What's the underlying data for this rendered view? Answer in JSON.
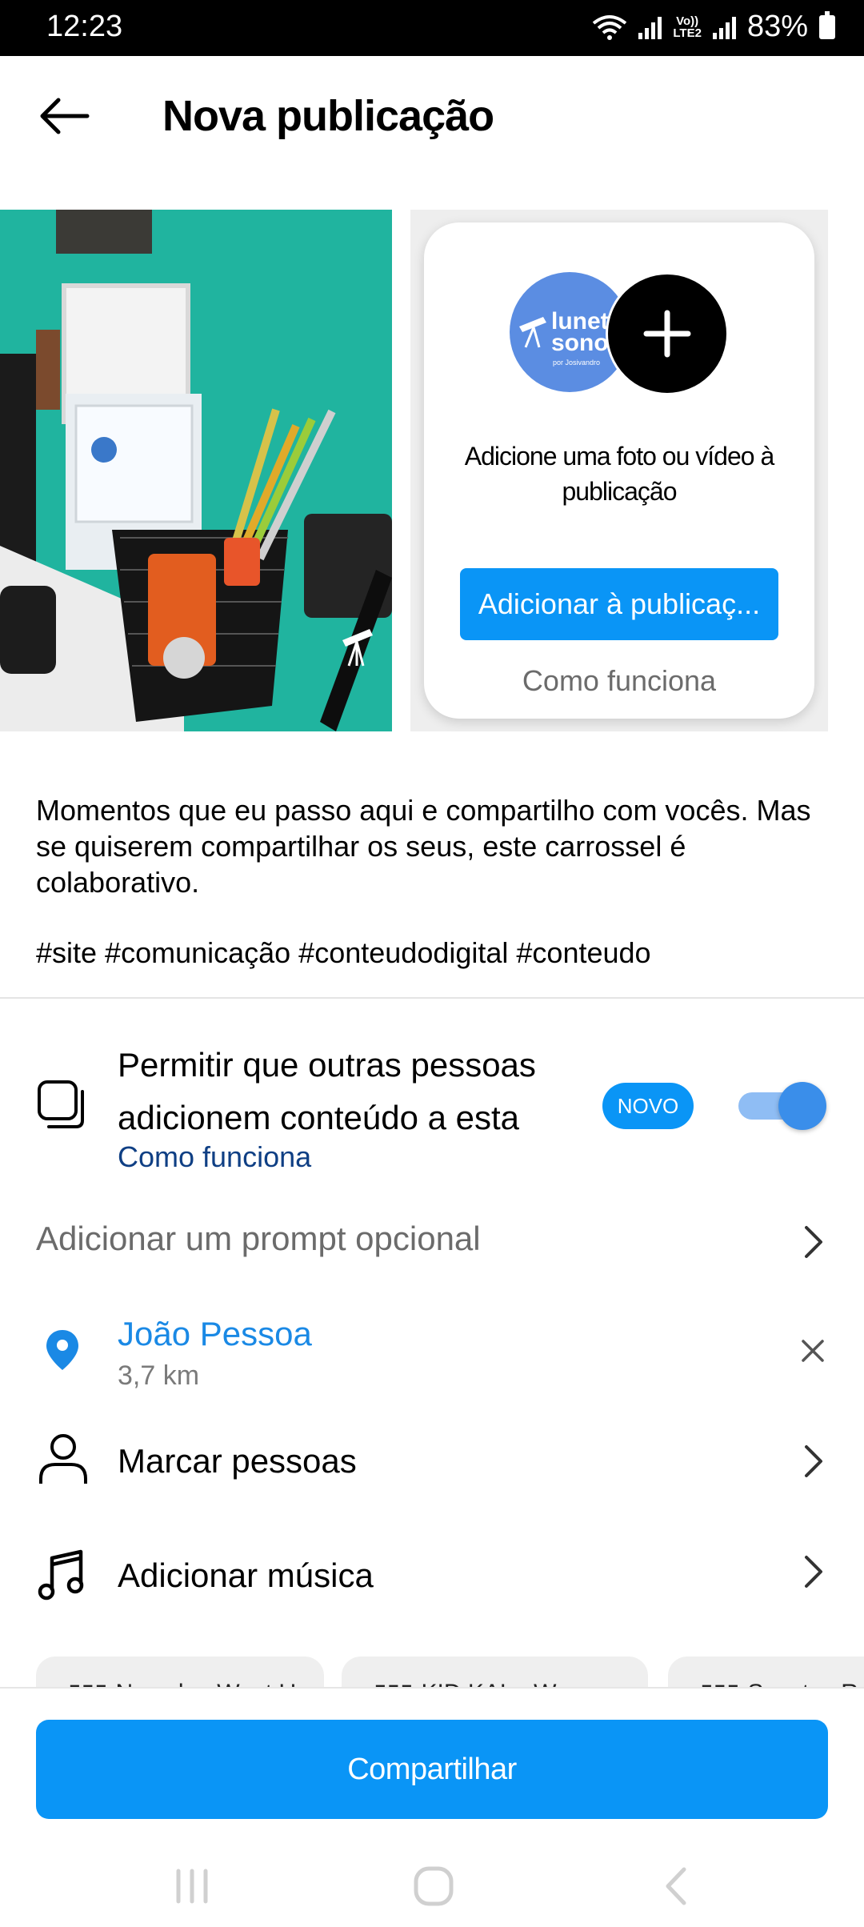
{
  "status_bar": {
    "time": "12:23",
    "battery": "83%",
    "lte_line1": "Vo))",
    "lte_line2": "LTE2"
  },
  "header": {
    "title": "Nova publicação",
    "back_icon": "arrow-left-icon"
  },
  "add_card": {
    "logo_line1": "lunet",
    "logo_line2": "sono",
    "logo_line3": "por Josivandro",
    "message": "Adicione uma foto ou vídeo à publicação",
    "button_label": "Adicionar à publicaç...",
    "how_it_works": "Como funciona"
  },
  "caption": {
    "text": "Momentos que eu passo aqui e compartilho com vocês. Mas se quiserem compartilhar os seus, este carrossel é colaborativo.",
    "hashtags": "#site #comunicação #conteudodigital #conteudo"
  },
  "collab": {
    "label": "Permitir que outras pessoas adicionem conteúdo a esta",
    "link": "Como funciona",
    "badge": "NOVO",
    "enabled": true
  },
  "rows": {
    "prompt": "Adicionar um prompt opcional",
    "location_name": "João Pessoa",
    "location_distance": "3,7 km",
    "tag_people": "Marcar pessoas",
    "add_music": "Adicionar música"
  },
  "music_chips": [
    {
      "label": "Nossdy · Want U"
    },
    {
      "label": "KID KAL · Warzone"
    },
    {
      "label": "Sanctus R"
    }
  ],
  "share_button": "Compartilhar",
  "colors": {
    "accent": "#0a95f6",
    "link_dark": "#0f3f84",
    "location_blue": "#1a89e5"
  }
}
